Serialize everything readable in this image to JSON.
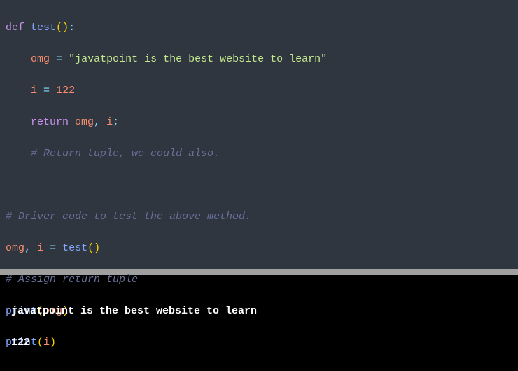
{
  "code": {
    "l1": {
      "def": "def",
      "sp1": " ",
      "fn": "test",
      "lp": "(",
      "rp": ")",
      "colon": ":"
    },
    "l2": {
      "indent": "    ",
      "var": "omg",
      "sp1": " ",
      "eq": "=",
      "sp2": " ",
      "str": "\"javatpoint is the best website to learn\""
    },
    "l3": {
      "indent": "    ",
      "var": "i",
      "sp1": " ",
      "eq": "=",
      "sp2": " ",
      "num": "122"
    },
    "l4": {
      "indent": "    ",
      "ret": "return",
      "sp1": " ",
      "v1": "omg",
      "comma": ",",
      "sp2": " ",
      "v2": "i",
      "semi": ";"
    },
    "l5": {
      "indent": "    ",
      "cmt": "# Return tuple, we could also."
    },
    "l6": {
      "blank": " "
    },
    "l7": {
      "cmt": "# Driver code to test the above method."
    },
    "l8": {
      "v1": "omg",
      "comma": ",",
      "sp1": " ",
      "v2": "i",
      "sp2": " ",
      "eq": "=",
      "sp3": " ",
      "fn": "test",
      "lp": "(",
      "rp": ")"
    },
    "l9": {
      "cmt": "# Assign return tuple"
    },
    "l10": {
      "fn": "print",
      "lp": "(",
      "arg": "omg",
      "rp": ")"
    },
    "l11": {
      "fn": "print",
      "lp": "(",
      "arg": "i",
      "rp": ")"
    }
  },
  "output": {
    "l1": "javatpoint is the best website to learn",
    "l2": "122"
  }
}
